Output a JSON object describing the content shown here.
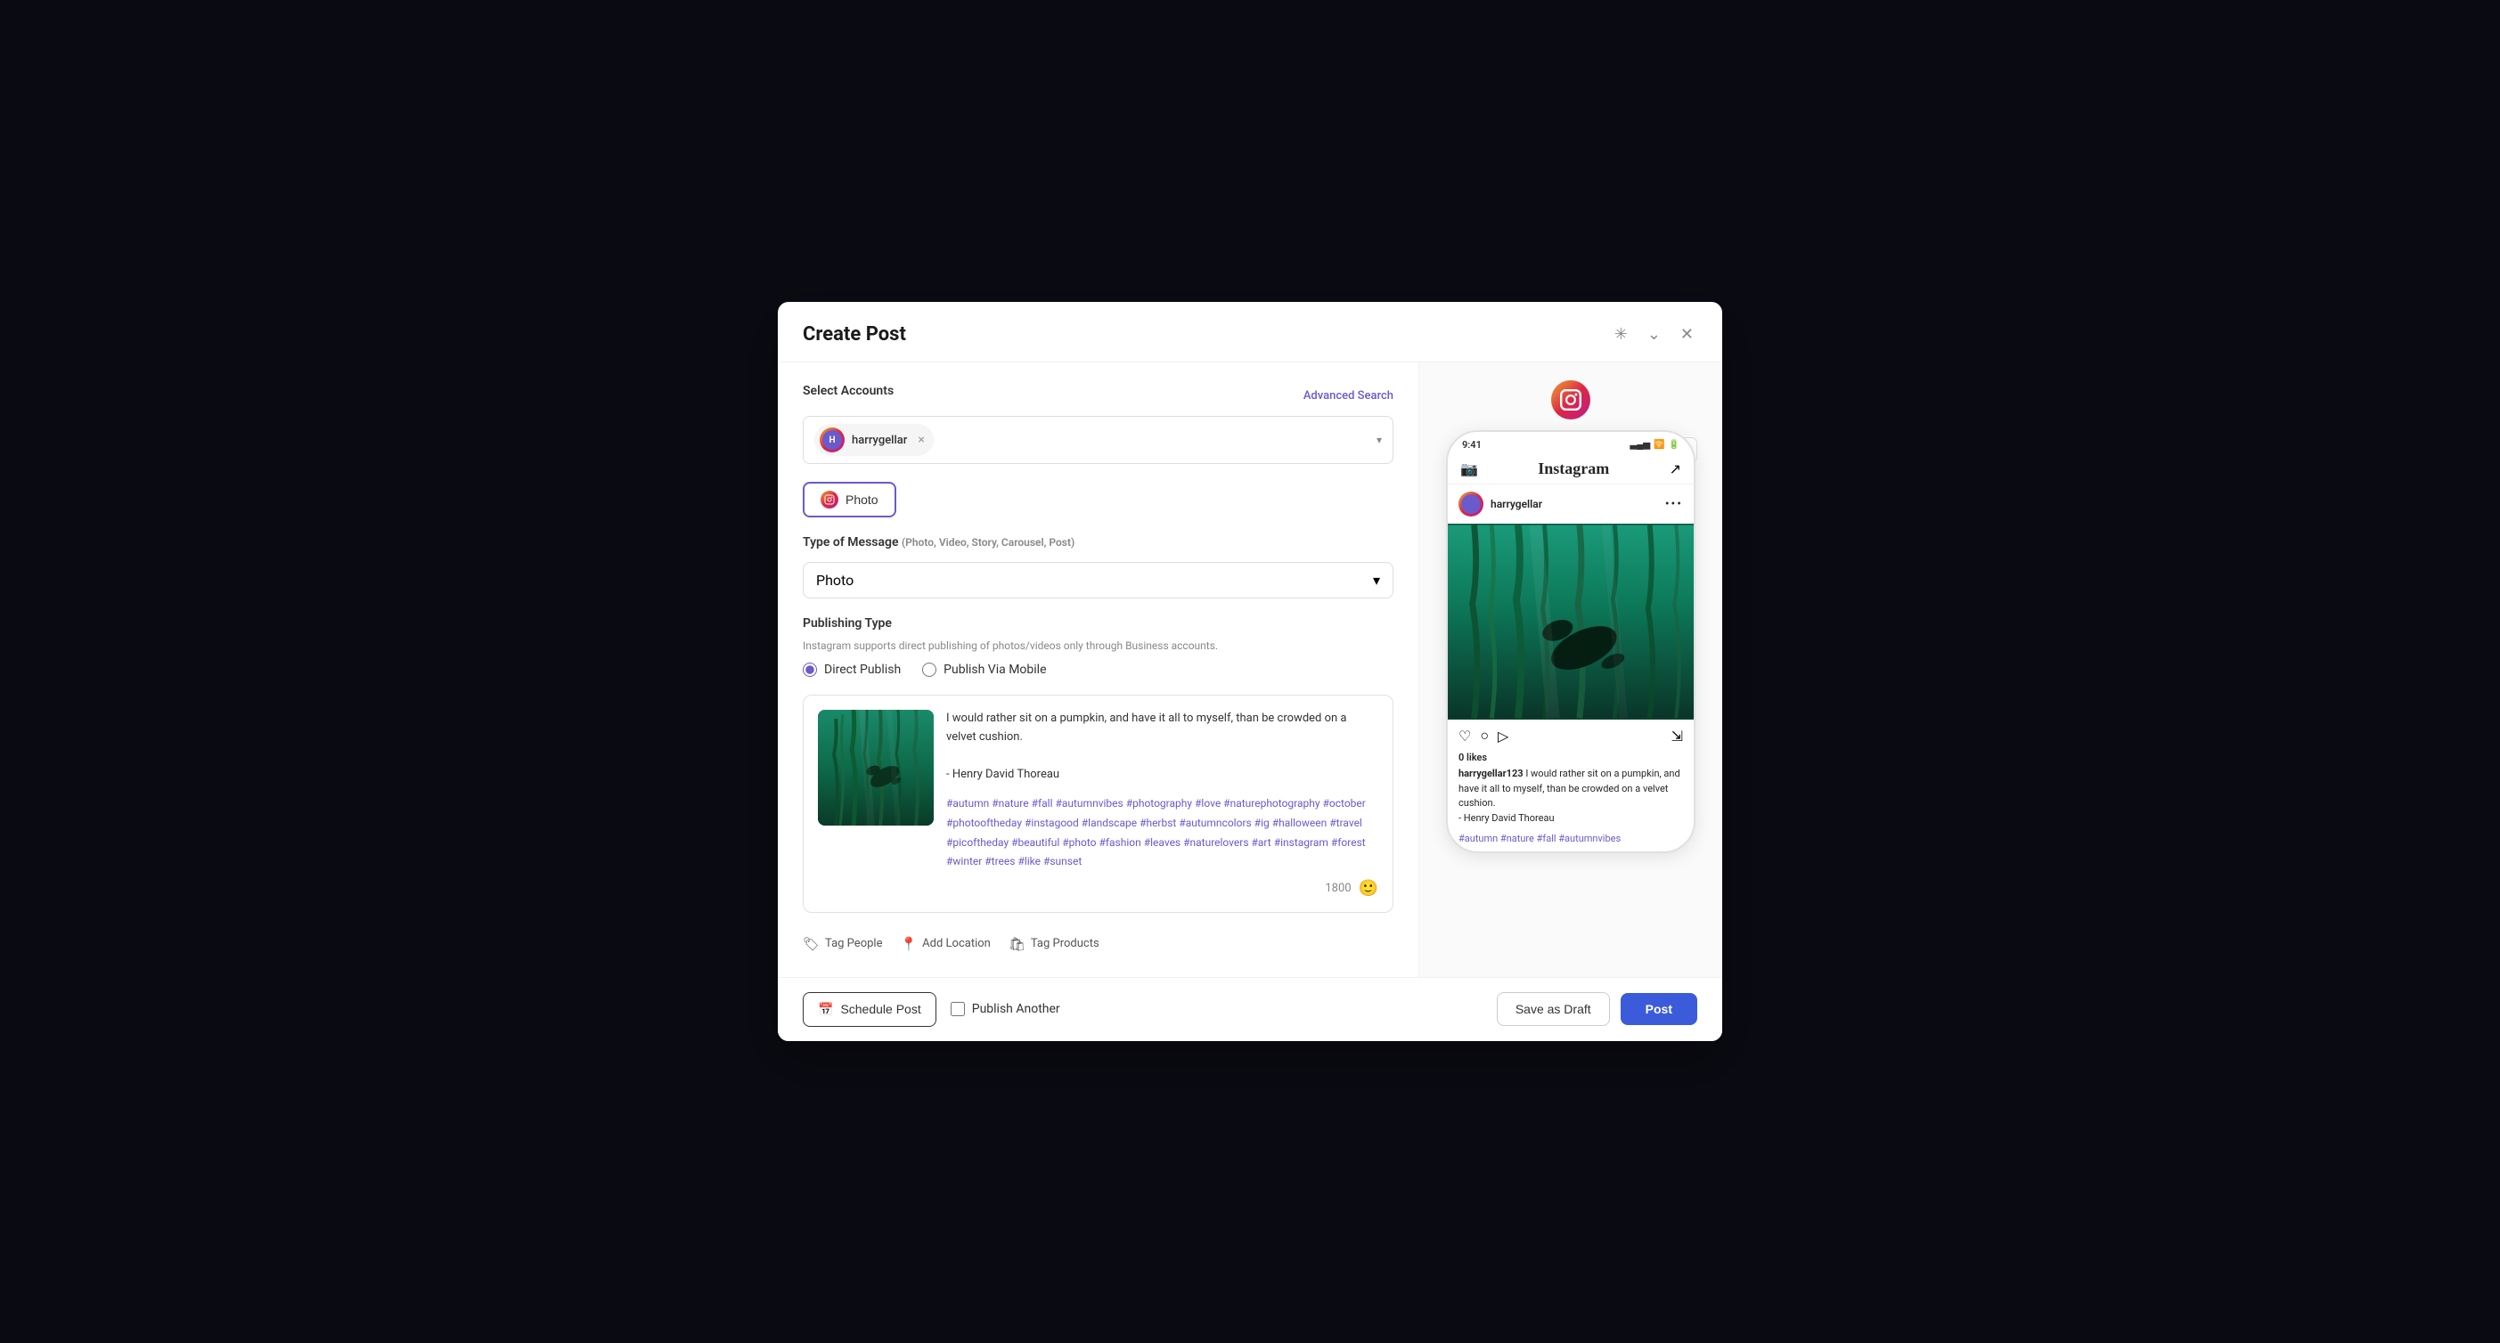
{
  "modal": {
    "title": "Create Post",
    "select_accounts_label": "Select Accounts",
    "advanced_search_label": "Advanced Search",
    "account_name": "harrygellar",
    "photo_type_label": "Photo",
    "type_of_message_label": "Type of Message",
    "type_of_message_hint": "(Photo, Video, Story, Carousel, Post)",
    "type_of_message_value": "Photo",
    "publishing_type_label": "Publishing Type",
    "publishing_desc": "Instagram supports direct publishing of photos/videos only through Business accounts.",
    "direct_publish_label": "Direct Publish",
    "publish_via_mobile_label": "Publish Via Mobile",
    "post_text": "I would rather sit on a pumpkin, and have it all to myself, than be crowded on a velvet cushion.\n\n- Henry David Thoreau",
    "hashtags": "#autumn #nature #fall #autumnvibes #photography #love #naturephotography #october #photooftheday #instagood #landscape #herbst #autumncolors #ig #halloween #travel #picoftheday #beautiful #photo #fashion #leaves #naturelovers #art #instagram #forest #winter #trees #like #sunset",
    "char_count": "1800",
    "tag_people_label": "Tag People",
    "add_location_label": "Add Location",
    "tag_products_label": "Tag Products",
    "schedule_post_label": "Schedule Post",
    "publish_another_label": "Publish Another",
    "save_draft_label": "Save as Draft",
    "post_label": "Post"
  },
  "preview": {
    "time": "9:41",
    "username": "harrygellar",
    "ig_username_caption": "harrygellar123",
    "caption_text": "I would rather sit on a pumpkin, and have it all to myself, than be crowded on a velvet cushion.",
    "caption_author": "- Henry David Thoreau",
    "hashtags_preview": "#autumn #nature #fall #autumnvibes",
    "likes": "0 likes"
  }
}
